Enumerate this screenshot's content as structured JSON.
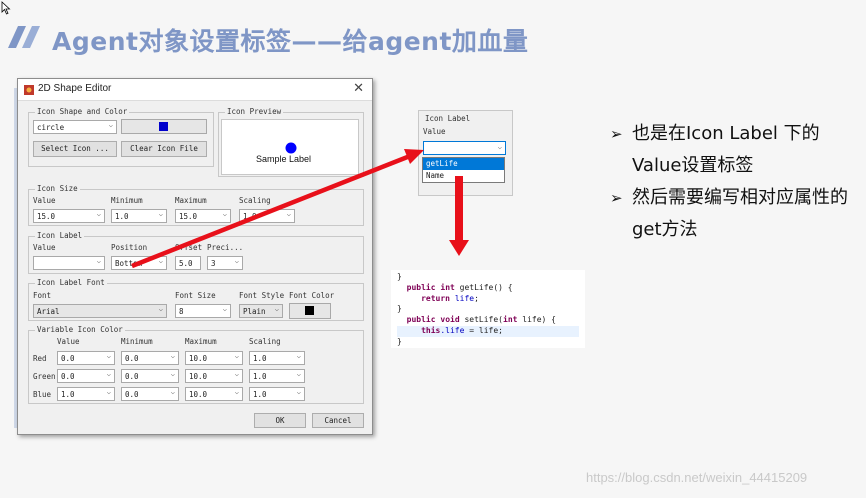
{
  "slide": {
    "title": "Agent对象设置标签——给agent加血量",
    "watermark": "https://blog.csdn.net/weixin_44415209"
  },
  "dialog": {
    "title": "2D Shape Editor",
    "close_glyph": "✕",
    "icon_shape_group": "Icon Shape and Color",
    "shape_value": "circle",
    "shape_color": "#0000cc",
    "select_icon_button": "Select Icon ...",
    "clear_icon_button": "Clear Icon File",
    "icon_preview_group": "Icon Preview",
    "preview_label": "Sample Label",
    "preview_dot_color": "#0000ff",
    "icon_size": {
      "group": "Icon Size",
      "value_label": "Value",
      "value": "15.0",
      "minimum_label": "Minimum",
      "minimum": "1.0",
      "maximum_label": "Maximum",
      "maximum": "15.0",
      "scaling_label": "Scaling",
      "scaling": "1.0"
    },
    "icon_label": {
      "group": "Icon Label",
      "value_label": "Value",
      "value": "",
      "position_label": "Position",
      "position": "Bottom",
      "offset_label": "Offset",
      "offset": "5.0",
      "precision_label": "Preci...",
      "precision": "3"
    },
    "icon_label_font": {
      "group": "Icon Label Font",
      "font_label": "Font",
      "font": "Arial",
      "size_label": "Font Size",
      "size": "8",
      "style_label": "Font Style",
      "style": "Plain",
      "color_label": "Font Color",
      "color": "#000000"
    },
    "variable_icon_color": {
      "group": "Variable Icon Color",
      "headers": [
        "Value",
        "Minimum",
        "Maximum",
        "Scaling"
      ],
      "rows": [
        {
          "name": "Red",
          "value": "0.0",
          "minimum": "0.0",
          "maximum": "10.0",
          "scaling": "1.0"
        },
        {
          "name": "Green",
          "value": "0.0",
          "minimum": "0.0",
          "maximum": "10.0",
          "scaling": "1.0"
        },
        {
          "name": "Blue",
          "value": "1.0",
          "minimum": "0.0",
          "maximum": "10.0",
          "scaling": "1.0"
        }
      ]
    },
    "ok_button": "OK",
    "cancel_button": "Cancel"
  },
  "icon_label_snippet": {
    "group": "Icon Label",
    "value_label": "Value",
    "options": [
      "getLife",
      "Name"
    ],
    "selected": "getLife"
  },
  "code": {
    "line0": "}",
    "line1_kw1": "public",
    "line1_kw2": "int",
    "line1_rest": " getLife() {",
    "line2_kw": "return",
    "line2_field": "life",
    "line2_rest": ";",
    "line3": "}",
    "line4_kw1": "public",
    "line4_kw2": "void",
    "line4_rest": " setLife(",
    "line4_kw3": "int",
    "line4_rest2": " life) {",
    "line5_kw": "this",
    "line5_field": ".life",
    "line5_rest": " = life;",
    "line6": "}"
  },
  "bullets": [
    {
      "marker": "➢",
      "text": "也是在Icon Label 下的Value设置标签"
    },
    {
      "marker": "➢",
      "text": "然后需要编写相对应属性的get方法"
    }
  ],
  "colors": {
    "title": "#7f96c6",
    "arrow": "#e8101a",
    "accent_blue": "#0078d7"
  }
}
